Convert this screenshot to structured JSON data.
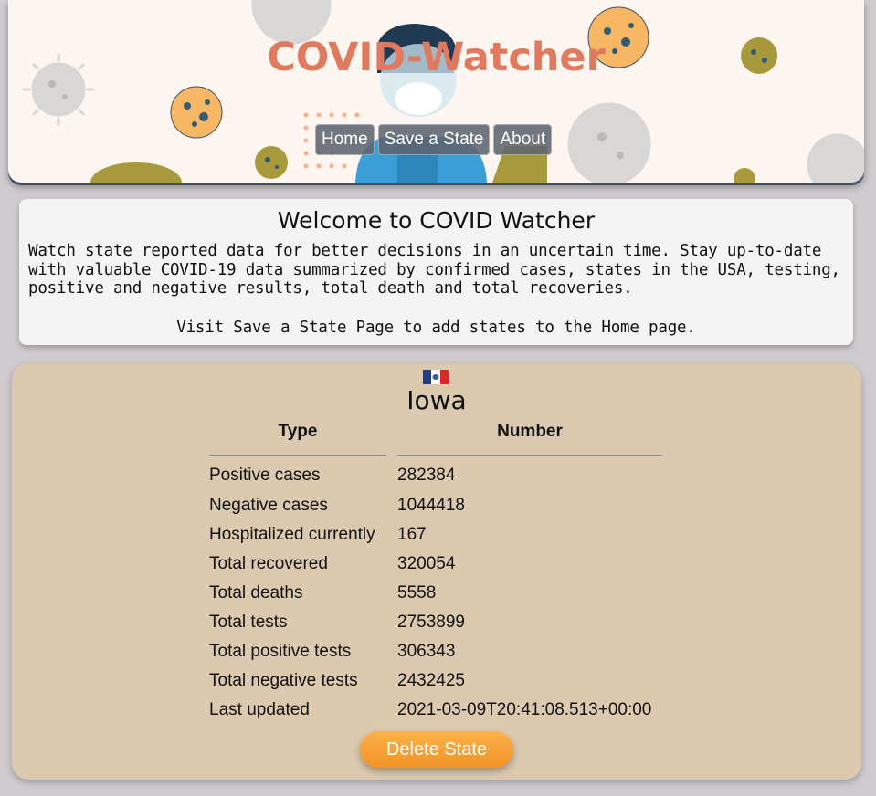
{
  "header": {
    "title": "COVID-Watcher",
    "nav": [
      "Home",
      "Save a State",
      "About"
    ]
  },
  "welcome": {
    "heading": "Welcome to COVID Watcher",
    "intro_lines": [
      "Watch state reported data for better decisions in an uncertain time. Stay up-to-date",
      "with valuable COVID-19 data summarized by confirmed cases, states in the USA, testing,",
      "positive and negative results, total death and total recoveries."
    ],
    "visit": "Visit Save a State Page to add states to the Home page."
  },
  "state": {
    "name": "Iowa",
    "columns": {
      "type": "Type",
      "number": "Number"
    },
    "rows": [
      {
        "label": "Positive cases",
        "value": "282384"
      },
      {
        "label": "Negative cases",
        "value": "1044418"
      },
      {
        "label": "Hospitalized currently",
        "value": "167"
      },
      {
        "label": "Total recovered",
        "value": "320054"
      },
      {
        "label": "Total deaths",
        "value": "5558"
      },
      {
        "label": "Total tests",
        "value": "2753899"
      },
      {
        "label": "Total positive tests",
        "value": "306343"
      },
      {
        "label": "Total negative tests",
        "value": "2432425"
      },
      {
        "label": "Last updated",
        "value": "2021-03-09T20:41:08.513+00:00"
      }
    ],
    "delete_label": "Delete State"
  },
  "colors": {
    "title": "#e07a5f",
    "card": "#dccab0",
    "delete_button": "#f5a032",
    "nav_button": "#5f646e"
  }
}
